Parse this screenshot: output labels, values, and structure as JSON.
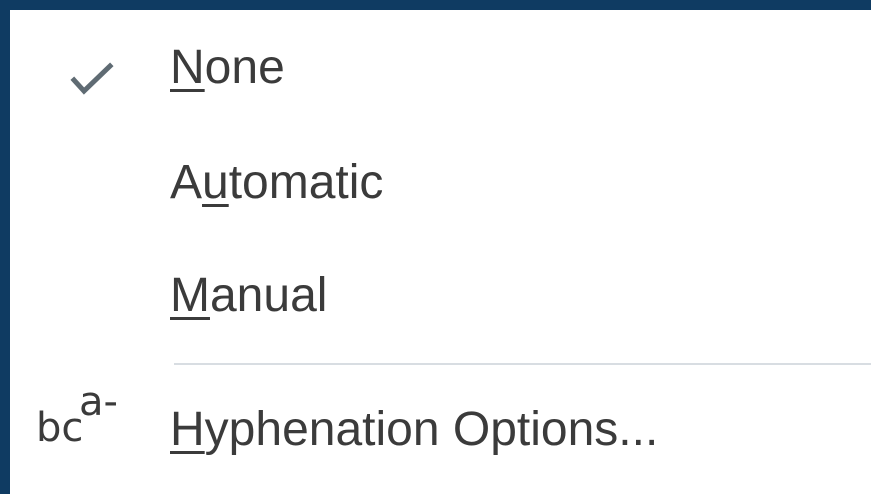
{
  "menu": {
    "items": [
      {
        "mnemonic": "N",
        "rest": "one",
        "checked": true,
        "icon": "checkmark-icon"
      },
      {
        "pre": "A",
        "mnemonic": "u",
        "rest": "tomatic",
        "checked": false
      },
      {
        "mnemonic": "M",
        "rest": "anual",
        "checked": false
      },
      {
        "mnemonic": "H",
        "rest": "yphenation Options...",
        "icon": "hyphenation-icon"
      }
    ],
    "hyphenation_icon": {
      "top": "a-",
      "bottom": "bc"
    }
  }
}
